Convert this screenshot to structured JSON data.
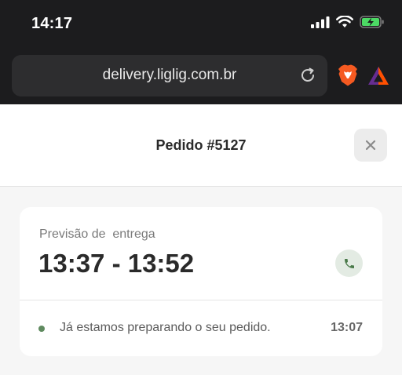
{
  "status_bar": {
    "time": "14:17",
    "icons": [
      "cellular-signal-icon",
      "wifi-icon",
      "battery-charging-icon"
    ]
  },
  "browser": {
    "url": "delivery.liglig.com.br",
    "icons": [
      "reload-icon",
      "brave-shield-icon",
      "brave-rewards-icon"
    ]
  },
  "header": {
    "title": "Pedido #5127",
    "close_icon": "close-icon"
  },
  "card": {
    "label": "Previsão de  entrega",
    "eta": "13:37 - 13:52",
    "phone_icon": "phone-icon",
    "status_message": "Já estamos preparando o seu pedido.",
    "status_time": "13:07"
  },
  "colors": {
    "accent_green": "#5f8a5f",
    "battery_green": "#4cd964",
    "brave_orange": "#f55a21"
  }
}
